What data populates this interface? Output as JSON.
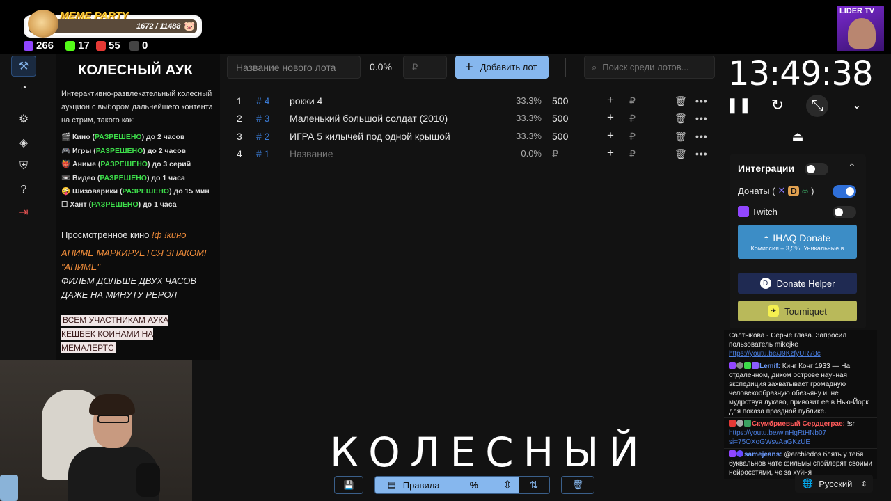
{
  "overlay": {
    "meme_party": {
      "title": "MEME PARTY",
      "count": "1672 / 11488"
    },
    "stats": [
      {
        "icon": "twitch-icon",
        "value": "266",
        "color": "#9146ff"
      },
      {
        "icon": "kick-icon",
        "value": "17",
        "color": "#53fc18"
      },
      {
        "icon": "live-icon",
        "value": "55",
        "color": "#e53935"
      },
      {
        "icon": "w-icon",
        "value": "0",
        "color": "#ffffff"
      }
    ],
    "channel_badge": "LIDER TV"
  },
  "rules": {
    "title": "КОЛЕСНЫЙ АУК",
    "description": "Интерактивно-развлекательный колесный аукцион с выбором дальнейшего контента на стрим, такого как:",
    "items": [
      {
        "icon": "🎬",
        "name": "Кино",
        "status": "РАЗРЕШЕНО",
        "limit": "до 2 часов"
      },
      {
        "icon": "🎮",
        "name": "Игры",
        "status": "РАЗРЕШЕНО",
        "limit": "до 2 часов"
      },
      {
        "icon": "👹",
        "name": "Аниме",
        "status": "РАЗРЕШЕНО",
        "limit": "до 3 серий"
      },
      {
        "icon": "📼",
        "name": "Видео",
        "status": "РАЗРЕШЕНО",
        "limit": "до 1 часа"
      },
      {
        "icon": "🤪",
        "name": "Шизоварики",
        "status": "РАЗРЕШЕНО",
        "limit": "до 15 мин"
      },
      {
        "icon": "☐",
        "name": "Хант",
        "status": "РАЗРЕШЕНО",
        "limit": "до 1  часа"
      }
    ],
    "watched_label": "Просмотренное кино",
    "watched_cmd": "!ф !кино",
    "anime_warning": "АНИМЕ МАРКИРУЕТСЯ ЗНАКОМ! \"АНИМЕ\"",
    "film_warning": "ФИЛЬМ ДОЛЬШЕ ДВУХ ЧАСОВ ДАЖЕ НА МИНУТУ РЕРОЛ",
    "cashback": "ВСЕМ УЧАСТНИКАМ АУКА КЕШБЕК КОИНАМИ НА МЕМАЛЕРТС"
  },
  "toolbar": {
    "lot_name_placeholder": "Название нового лота",
    "percent": "0.0%",
    "price_placeholder": "₽",
    "add_button": "Добавить лот",
    "search_placeholder": "Поиск среди лотов..."
  },
  "lots": [
    {
      "num": "1",
      "id": "# 4",
      "name": "рокки 4",
      "percent": "33.3%",
      "amount": "500",
      "placeholder": false
    },
    {
      "num": "2",
      "id": "# 3",
      "name": "Маленький большой солдат (2010)",
      "percent": "33.3%",
      "amount": "500",
      "placeholder": false
    },
    {
      "num": "3",
      "id": "# 2",
      "name": "ИГРА 5 килычей под одной крышой",
      "percent": "33.3%",
      "amount": "500",
      "placeholder": false
    },
    {
      "num": "4",
      "id": "# 1",
      "name": "Название",
      "percent": "0.0%",
      "amount": "₽",
      "placeholder": true
    }
  ],
  "lot_actions": {
    "plus": "+",
    "rub": "₽",
    "delete": "🗑",
    "more": "•••"
  },
  "timer": {
    "value": "13:49:38"
  },
  "integrations": {
    "title": "Интеграции",
    "donations_label": "Донаты (",
    "donations_suffix": ")",
    "twitch_label": "Twitch",
    "ihaq_title": "IHAQ Donate",
    "ihaq_subtitle": "Комиссия – 3,5%. Уникальные в",
    "donate_helper": "Donate Helper",
    "tourniquet": "Tourniquet"
  },
  "chat": [
    {
      "user": "",
      "text": "Салтыкова - Серые глаза. Запросил пользователь mikejke",
      "link": "https://youtu.be/J9KzfyUR78c"
    },
    {
      "user": "Lemif:",
      "text": " Кинг Конг 1933 — На отдаленном, диком острове научная экспедиция захватывает громадную человекообразную обезьяну и, не мудрствуя лукаво, привозит ее в Нью-Йорк для показа праздной публике.",
      "link": ""
    },
    {
      "user": "Скумбриевый Сердцеграе:",
      "text": " !sr",
      "link": "https://youtu.be/winHgRtHNb07 si=75OXoGWsvAaGKzUE"
    },
    {
      "user": "samejeans:",
      "text": " @archiedos блять у тебя буквальнов чате фильмы спойлерят своими нейросетями, че за хуйня",
      "link": ""
    }
  ],
  "language": "Русский",
  "banner_word": "КОЛЕСНЫЙ",
  "bottom_toolbar": {
    "rules_label": "Правила",
    "percent_symbol": "%"
  }
}
